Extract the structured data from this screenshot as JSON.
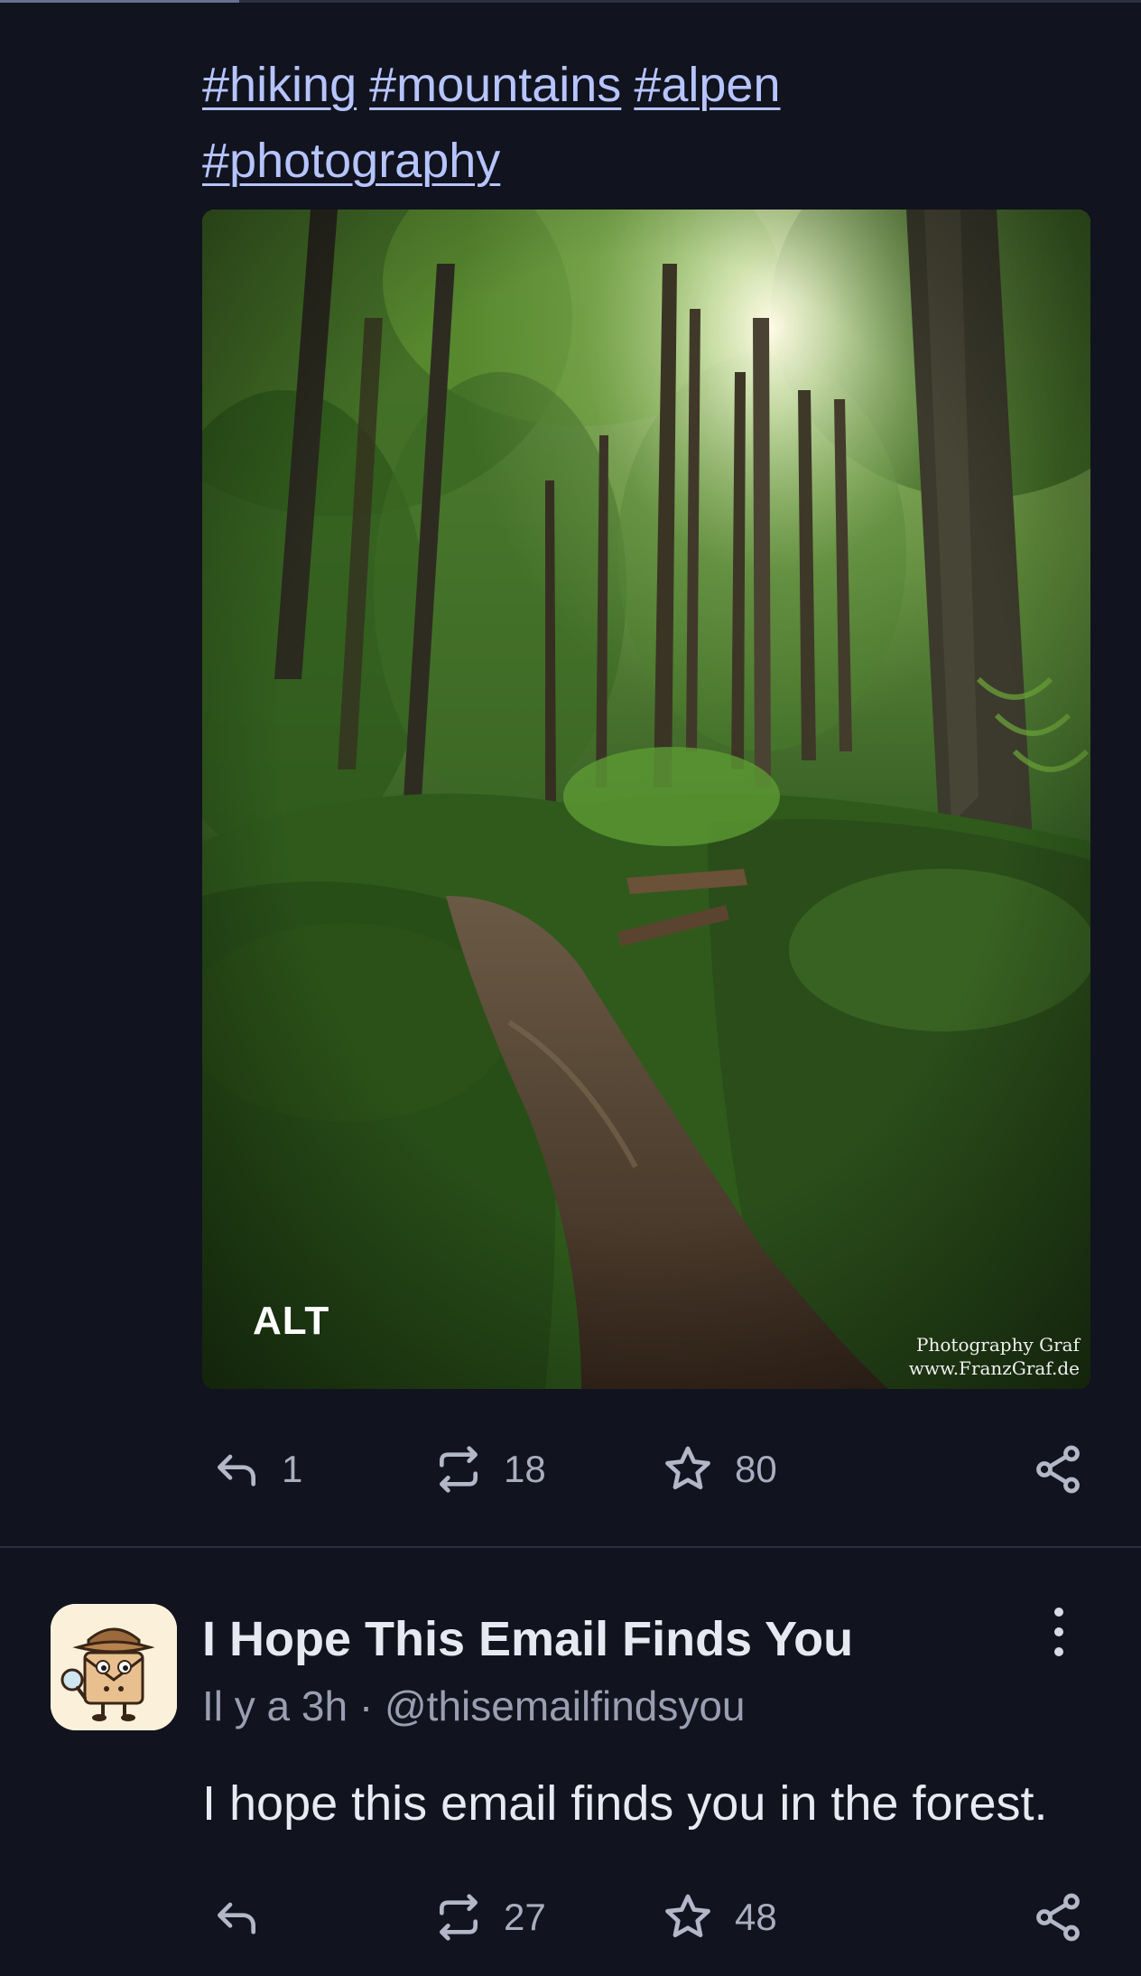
{
  "post1": {
    "hashtags": [
      "#hiking",
      "#mountains",
      "#alpen",
      "#photography"
    ],
    "image": {
      "alt_badge": "ALT",
      "watermark_line1": "Photography Graf",
      "watermark_line2": "www.FranzGraf.de"
    },
    "actions": {
      "replies": "1",
      "boosts": "18",
      "favourites": "80"
    }
  },
  "post2": {
    "display_name": "I Hope This Email Finds You",
    "time": "Il y a 3h",
    "separator": "·",
    "handle": "@thisemailfindsyou",
    "text": "I hope this email finds you in the forest.",
    "actions": {
      "replies": "",
      "boosts": "27",
      "favourites": "48"
    }
  },
  "icons": [
    "reply-icon",
    "boost-icon",
    "favourite-star-icon",
    "share-icon",
    "more-options-icon"
  ],
  "colors": {
    "background": "#11131e",
    "hashtag": "#b6c4ff",
    "muted": "#a9adbf",
    "text": "#e6e8f2"
  }
}
